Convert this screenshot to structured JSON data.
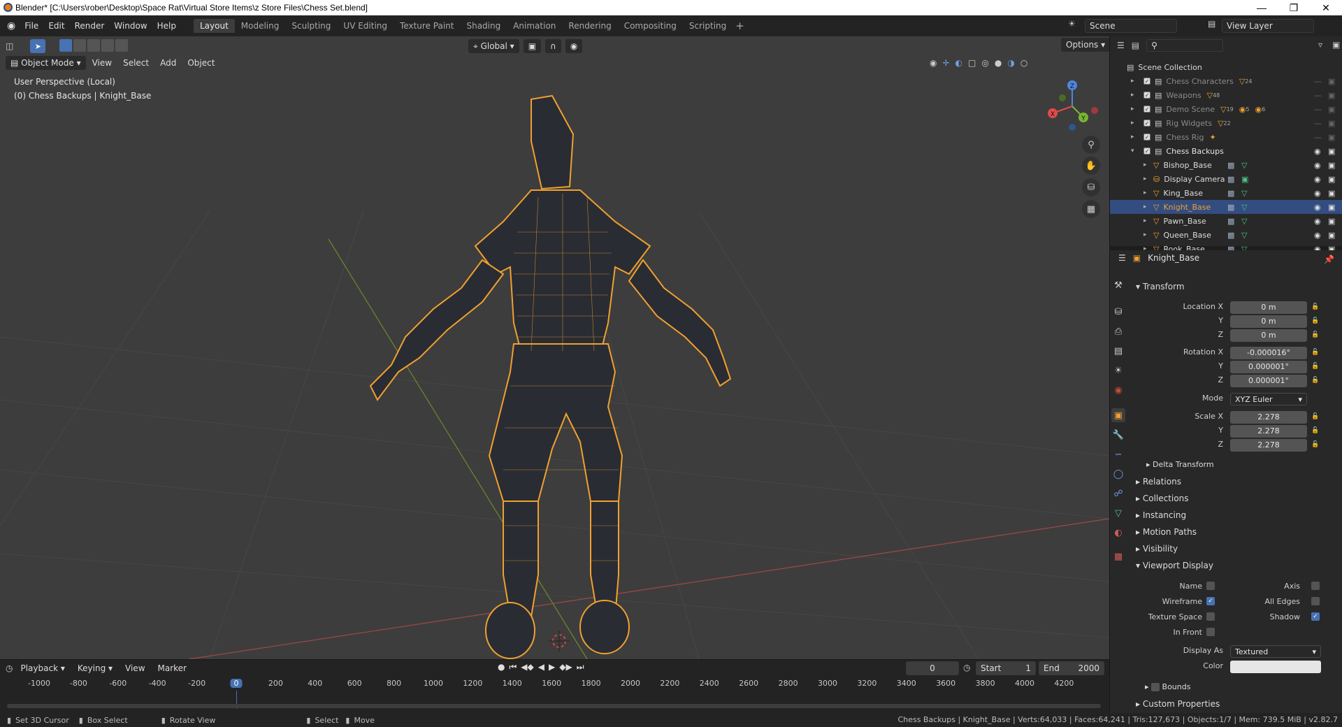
{
  "window": {
    "title": "Blender* [C:\\Users\\rober\\Desktop\\Space Rat\\Virtual Store Items\\z Store Files\\Chess Set.blend]"
  },
  "menus": [
    "File",
    "Edit",
    "Render",
    "Window",
    "Help"
  ],
  "workspaces": [
    "Layout",
    "Modeling",
    "Sculpting",
    "UV Editing",
    "Texture Paint",
    "Shading",
    "Animation",
    "Rendering",
    "Compositing",
    "Scripting"
  ],
  "active_workspace": "Layout",
  "scene": {
    "scene_name": "Scene",
    "view_layer": "View Layer"
  },
  "viewport": {
    "mode": "Object Mode",
    "menus": [
      "View",
      "Select",
      "Add",
      "Object"
    ],
    "transform_orientation": "Global",
    "options_label": "Options",
    "overlay_line1": "User Perspective (Local)",
    "overlay_line2": "(0) Chess Backups | Knight_Base",
    "gizmo": {
      "z": "Z",
      "y": "Y",
      "x": "X"
    }
  },
  "outliner": {
    "root": "Scene Collection",
    "collections": [
      {
        "name": "Chess Characters",
        "count": "24"
      },
      {
        "name": "Weapons",
        "count": "48"
      },
      {
        "name": "Demo Scene",
        "count": "19"
      },
      {
        "name": "Rig Widgets",
        "count": "22"
      },
      {
        "name": "Chess Rig",
        "count": ""
      },
      {
        "name": "Chess Backups",
        "count": ""
      }
    ],
    "demo_scene_extra": [
      "5",
      "6"
    ],
    "objects": [
      "Bishop_Base",
      "Display Camera",
      "King_Base",
      "Knight_Base",
      "Pawn_Base",
      "Queen_Base",
      "Rook_Base"
    ],
    "selected": "Knight_Base"
  },
  "properties": {
    "object_name": "Knight_Base",
    "transform_title": "Transform",
    "location": {
      "label": "Location X",
      "x": "0 m",
      "y": "0 m",
      "z": "0 m"
    },
    "rotation": {
      "label": "Rotation X",
      "x": "-0.000016°",
      "y": "0.000001°",
      "z": "0.000001°"
    },
    "mode_label": "Mode",
    "mode_value": "XYZ Euler",
    "scale": {
      "label": "Scale X",
      "x": "2.278",
      "y": "2.278",
      "z": "2.278"
    },
    "axis_y": "Y",
    "axis_z": "Z",
    "delta_transform": "Delta Transform",
    "sections": [
      "Relations",
      "Collections",
      "Instancing",
      "Motion Paths",
      "Visibility"
    ],
    "viewport_display": {
      "title": "Viewport Display",
      "name": "Name",
      "axis": "Axis",
      "wireframe": "Wireframe",
      "all_edges": "All Edges",
      "texture_space": "Texture Space",
      "shadow": "Shadow",
      "in_front": "In Front",
      "display_as_label": "Display As",
      "display_as_value": "Textured",
      "color_label": "Color",
      "wireframe_on": true,
      "shadow_on": true,
      "bounds": "Bounds"
    },
    "custom_properties": "Custom Properties"
  },
  "timeline": {
    "menus": [
      "Playback",
      "Keying",
      "View",
      "Marker"
    ],
    "current_frame": "0",
    "start_label": "Start",
    "start_value": "1",
    "end_label": "End",
    "end_value": "2000",
    "ticks": [
      "-1000",
      "-800",
      "-600",
      "-400",
      "-200",
      "0",
      "200",
      "400",
      "600",
      "800",
      "1000",
      "1200",
      "1400",
      "1600",
      "1800",
      "2000",
      "2200",
      "2400",
      "2600",
      "2800",
      "3000",
      "3200",
      "3400",
      "3600",
      "3800",
      "4000",
      "4200"
    ],
    "playhead": "0"
  },
  "statusbar": {
    "left": [
      "Set 3D Cursor",
      "Box Select",
      "Rotate View",
      "Select",
      "Move"
    ],
    "right": "Chess Backups | Knight_Base | Verts:64,033 | Faces:64,241 | Tris:127,673 | Objects:1/7 | Mem: 739.5 MiB | v2.82.7"
  },
  "colors": {
    "accent": "#4772b3",
    "selection": "#f0a030",
    "selected_row": "#334d80"
  }
}
